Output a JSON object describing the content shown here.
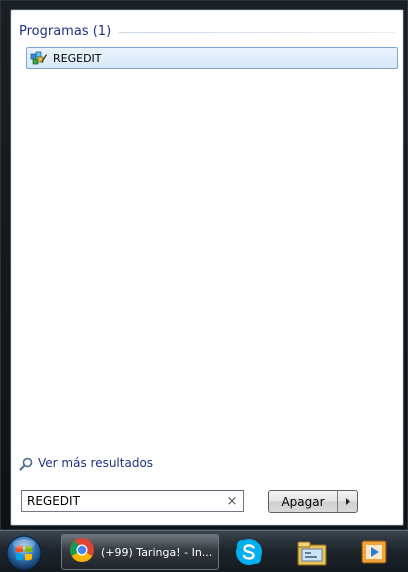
{
  "search_results": {
    "group_title": "Programas (1)",
    "items": [
      {
        "label": "REGEDIT",
        "icon": "regedit-icon"
      }
    ],
    "see_more_label": "Ver más resultados",
    "see_more_icon": "magnifier-icon"
  },
  "search": {
    "value": "REGEDIT",
    "clear_icon": "×"
  },
  "shutdown": {
    "label": "Apagar",
    "arrow_icon": "chevron-right-icon"
  },
  "taskbar": {
    "start_icon": "windows-start-orb-icon",
    "tasks": [
      {
        "label": "(+99) Taringa! - In...",
        "icon": "chrome-icon"
      }
    ],
    "pinned": [
      "skype-icon",
      "windows-explorer-icon",
      "media-player-icon"
    ]
  },
  "colors": {
    "group_title": "#1e3287",
    "selection_border": "#7fa6d6",
    "selection_fill": "#d7e8f9",
    "taskbar": "#1e252c"
  }
}
